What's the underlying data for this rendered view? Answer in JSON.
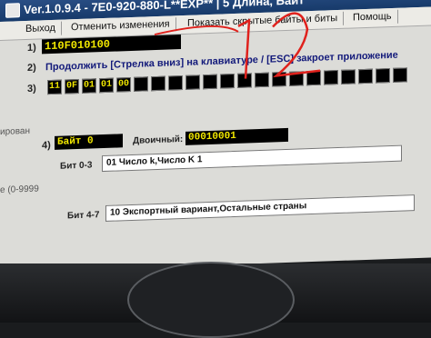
{
  "window": {
    "title": "Ver.1.0.9.4 -   7E0-920-880-L**EXP** | 5 Длина, Байт"
  },
  "menu": [
    "Выход",
    "Отменить изменения",
    "Показать скрытые байты и биты",
    "Помощь"
  ],
  "row1": {
    "number": "1)",
    "value": "110F010100"
  },
  "row2": {
    "number": "2)",
    "text": "Продолжить [Стрелка вниз] на клавиатуре / [ESC] закроет приложение"
  },
  "row3": {
    "number": "3)",
    "bytes": [
      "11",
      "0F",
      "01",
      "01",
      "00"
    ],
    "empty_cells": 16
  },
  "row4": {
    "number": "4)",
    "byte_label": "Байт 0",
    "binary_label": "Двоичный:",
    "binary_value": "00010001"
  },
  "bits": [
    {
      "label": "Бит 0-3",
      "value": "01 Число k,Число K 1"
    },
    {
      "label": "Бит 4-7",
      "value": "10 Экспортный вариант,Остальные страны"
    }
  ],
  "left_edge": [
    "ирован",
    "е (0-9999"
  ],
  "colors": {
    "field_bg": "#000000",
    "field_text": "#f2e800",
    "prompt_text": "#12197a",
    "titlebar": "#1f4478",
    "annotation_red": "#e0211c"
  },
  "icons": [
    "app-icon",
    "steering-wheel-icon"
  ]
}
